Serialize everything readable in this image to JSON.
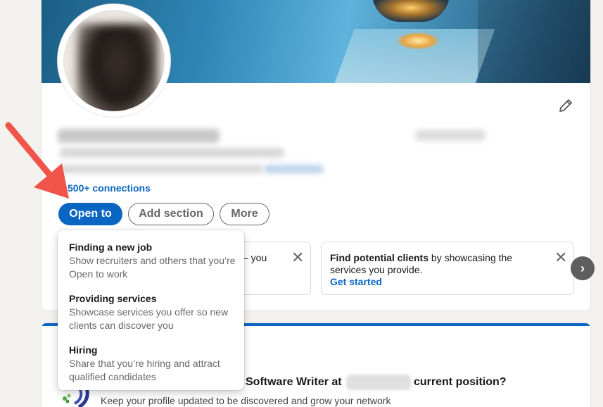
{
  "profile": {
    "connections_label": "500+ connections",
    "name_redacted": "",
    "headline_redacted": ""
  },
  "actions": {
    "open_to_label": "Open to",
    "add_section_label": "Add section",
    "more_label": "More"
  },
  "open_to_menu": {
    "items": [
      {
        "title": "Finding a new job",
        "description": "Show recruiters and others that you’re Open to work"
      },
      {
        "title": "Providing services",
        "description": "Showcase services you offer so new clients can discover you"
      },
      {
        "title": "Hiring",
        "description": "Share that you’re hiring and attract qualified candidates"
      }
    ]
  },
  "suggestions": {
    "card1_tail": "– you",
    "card2_bold": "Find potential clients",
    "card2_rest": " by showcasing the services you provide.",
    "card2_link": "Get started",
    "close_glyph": "✕",
    "next_glyph": "›"
  },
  "position_prompt": {
    "question_part1": "Software Writer at",
    "question_part2": "current position?",
    "subtitle": "Keep your profile updated to be discovered and grow your network"
  },
  "colors": {
    "primary": "#0a66c2",
    "annotation_arrow": "#f0544a"
  }
}
